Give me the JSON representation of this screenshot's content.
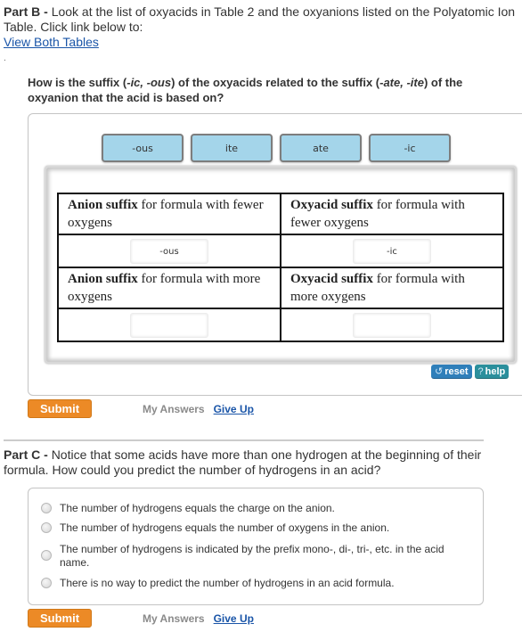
{
  "part_b": {
    "label": "Part B - ",
    "text": "Look at the list of oxyacids in Table 2 and the oxyanions listed on the Polyatomic Ion Table. Click link below to:",
    "link": "View Both Tables",
    "dot": ".",
    "question_pre": "How is the suffix (",
    "question_ic": "-ic, -ous",
    "question_mid": ") of the oxyacids related to the suffix (",
    "question_ate": "-ate, -ite",
    "question_post": ") of the oxyanion that the acid is based on?",
    "chips": [
      "-ous",
      "ite",
      "ate",
      "-ic"
    ],
    "table": {
      "rows": [
        {
          "type": "header",
          "cells": [
            {
              "bold": "Anion suffix",
              "rest": " for formula with fewer oxygens"
            },
            {
              "bold": "Oxyacid suffix",
              "rest": " for formula with fewer oxygens"
            }
          ]
        },
        {
          "type": "drop",
          "cells": [
            "-ous",
            "-ic"
          ]
        },
        {
          "type": "header",
          "cells": [
            {
              "bold": "Anion suffix",
              "rest": " for formula with more oxygens"
            },
            {
              "bold": "Oxyacid suffix",
              "rest": " for formula with more oxygens"
            }
          ]
        },
        {
          "type": "drop",
          "cells": [
            "",
            ""
          ]
        }
      ]
    },
    "reset_icon": "↺",
    "reset_label": "reset",
    "help_icon": "?",
    "help_label": "help",
    "submit": "Submit",
    "my_answers": "My Answers",
    "give_up": "Give Up"
  },
  "part_c": {
    "label": "Part C - ",
    "text": "Notice that some acids have more than one hydrogen at the beginning of their formula. How could you predict the number of hydrogens in an acid?",
    "choices": [
      "The number of hydrogens equals the charge on the anion.",
      "The number of hydrogens equals the number of oxygens in the anion.",
      "The number of hydrogens is indicated by the prefix mono-, di-, tri-, etc. in the acid name.",
      "There is no way to predict the number of hydrogens in an acid formula."
    ],
    "submit": "Submit",
    "my_answers": "My Answers",
    "give_up": "Give Up"
  },
  "colors": {
    "chip": "#a4d5ea",
    "submit": "#ec8a26",
    "link": "#1a55a8",
    "reset": "#2f7fba",
    "help": "#2b8f9c"
  }
}
